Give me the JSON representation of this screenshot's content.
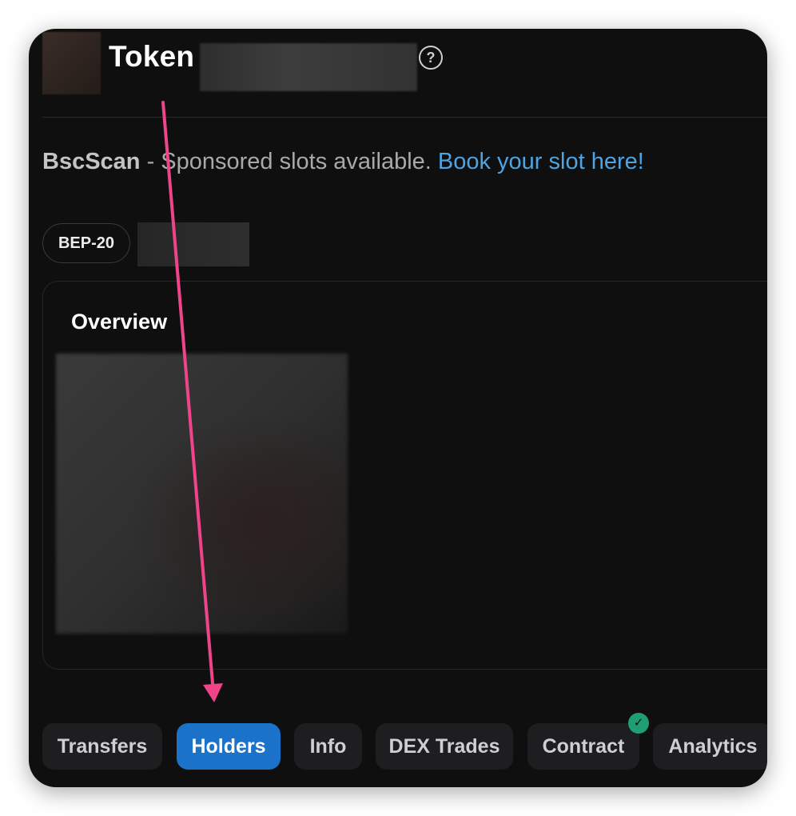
{
  "header": {
    "title": "Token",
    "help_icon": "?"
  },
  "sponsored": {
    "brand": "BscScan",
    "text": " - Sponsored slots available. ",
    "link": "Book your slot here!"
  },
  "badge": {
    "label": "BEP-20"
  },
  "overview": {
    "title": "Overview"
  },
  "tabs": [
    {
      "label": "Transfers",
      "active": false
    },
    {
      "label": "Holders",
      "active": true
    },
    {
      "label": "Info",
      "active": false
    },
    {
      "label": "DEX Trades",
      "active": false
    },
    {
      "label": "Contract",
      "active": false,
      "verified": true
    },
    {
      "label": "Analytics",
      "active": false
    }
  ],
  "colors": {
    "background": "#0f0f10",
    "accent": "#1a73c9",
    "link": "#4ea3e0",
    "verified": "#1e9e72",
    "annotation_arrow": "#f0448a"
  },
  "icons": {
    "help": "question-circle-icon",
    "verified": "check-circle-icon",
    "annotation": "arrow-down-icon"
  }
}
